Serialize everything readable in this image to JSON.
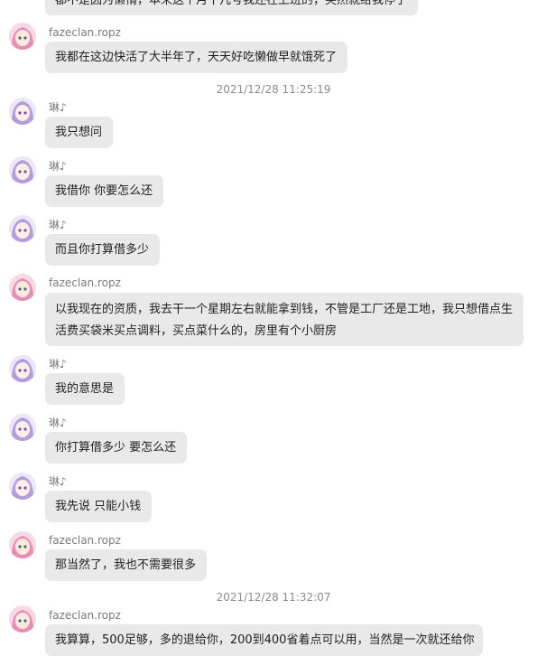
{
  "chat": {
    "partial_top_message": "都不是因为懒惰，本来这个月十几号我还在上班的，突然就给我停了",
    "timestamps": [
      "2021/12/28 11:25:19",
      "2021/12/28 11:32:07"
    ],
    "messages": [
      {
        "sender": "fazeclan.ropz",
        "text": "我都在这边快活了大半年了，天天好吃懒做早就饿死了"
      },
      {
        "sender": "琳♪",
        "text": "我只想问"
      },
      {
        "sender": "琳♪",
        "text": "我借你 你要怎么还"
      },
      {
        "sender": "琳♪",
        "text": "而且你打算借多少"
      },
      {
        "sender": "fazeclan.ropz",
        "text": "以我现在的资质，我去干一个星期左右就能拿到钱，不管是工厂还是工地，我只想借点生活费买袋米买点调料，买点菜什么的，房里有个小厨房"
      },
      {
        "sender": "琳♪",
        "text": "我的意思是"
      },
      {
        "sender": "琳♪",
        "text": "你打算借多少 要怎么还"
      },
      {
        "sender": "琳♪",
        "text": "我先说 只能小钱"
      },
      {
        "sender": "fazeclan.ropz",
        "text": "那当然了，我也不需要很多"
      },
      {
        "sender": "fazeclan.ropz",
        "text": "我算算，500足够，多的退给你，200到400省着点可以用，当然是一次就还给你"
      }
    ]
  },
  "colors": {
    "bubble": "#e9e9e9",
    "sender_name": "#7a7a7a",
    "timestamp": "#8a8a8a",
    "avatar_faze": "#e48fb6",
    "avatar_lin": "#b39ddb"
  }
}
